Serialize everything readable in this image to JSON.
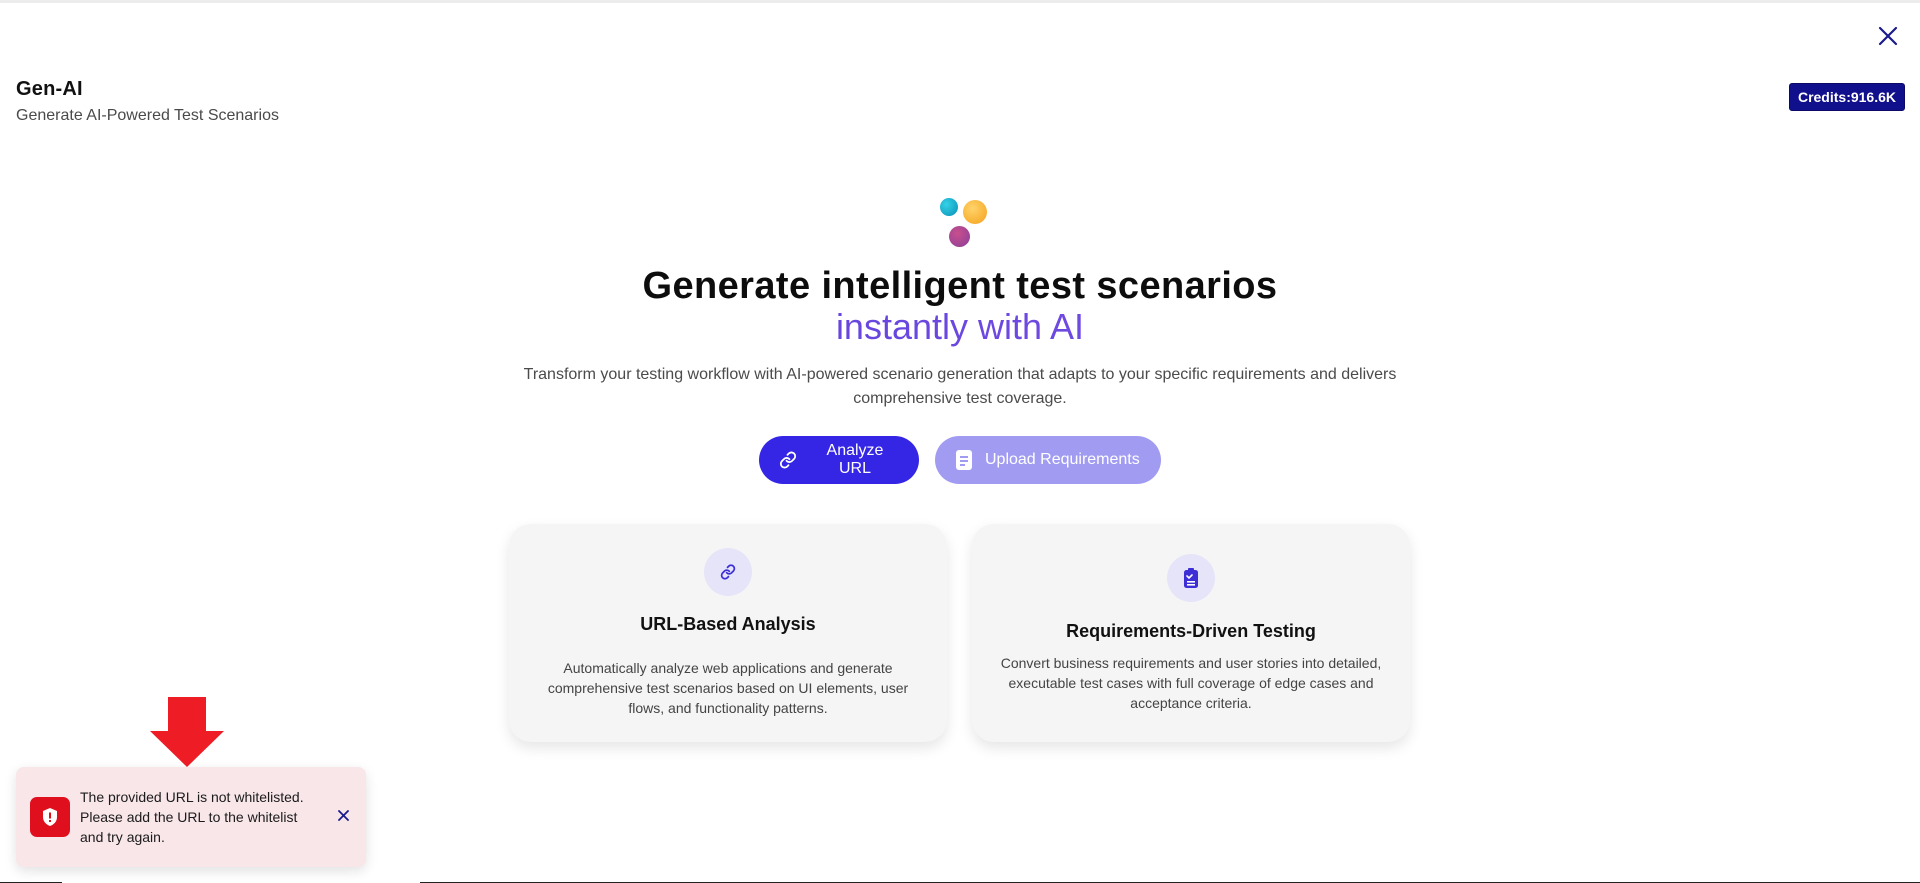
{
  "header": {
    "title": "Gen-AI",
    "subtitle": "Generate AI-Powered Test Scenarios"
  },
  "credits": {
    "label": "Credits:916.6K",
    "color": "#10108c"
  },
  "hero": {
    "title": "Generate intelligent test scenarios",
    "accent": "instantly with AI",
    "description": "Transform your testing workflow with AI-powered scenario generation that adapts to your specific requirements and delivers comprehensive test coverage."
  },
  "actions": {
    "analyze_label": "Analyze URL",
    "analyze_icon": "link-icon",
    "upload_label": "Upload Requirements",
    "upload_icon": "document-icon"
  },
  "cards": [
    {
      "icon": "link-icon",
      "title": "URL-Based Analysis",
      "description": "Automatically analyze web applications and generate comprehensive test scenarios based on UI elements, user flows, and functionality patterns."
    },
    {
      "icon": "clipboard-check-icon",
      "title": "Requirements-Driven Testing",
      "description": "Convert business requirements and user stories into detailed, executable test cases with full coverage of edge cases and acceptance criteria."
    }
  ],
  "toast": {
    "icon": "shield-alert-icon",
    "message": "The provided URL is not whitelisted. Please add the URL to the whitelist and try again.",
    "color": "#e00f1e"
  },
  "colors": {
    "primary": "#3526e6",
    "primary_light": "#a19cf2",
    "accent_start": "#4a3bd8",
    "accent_end": "#8b55e8",
    "annotation": "#ee1c25"
  }
}
